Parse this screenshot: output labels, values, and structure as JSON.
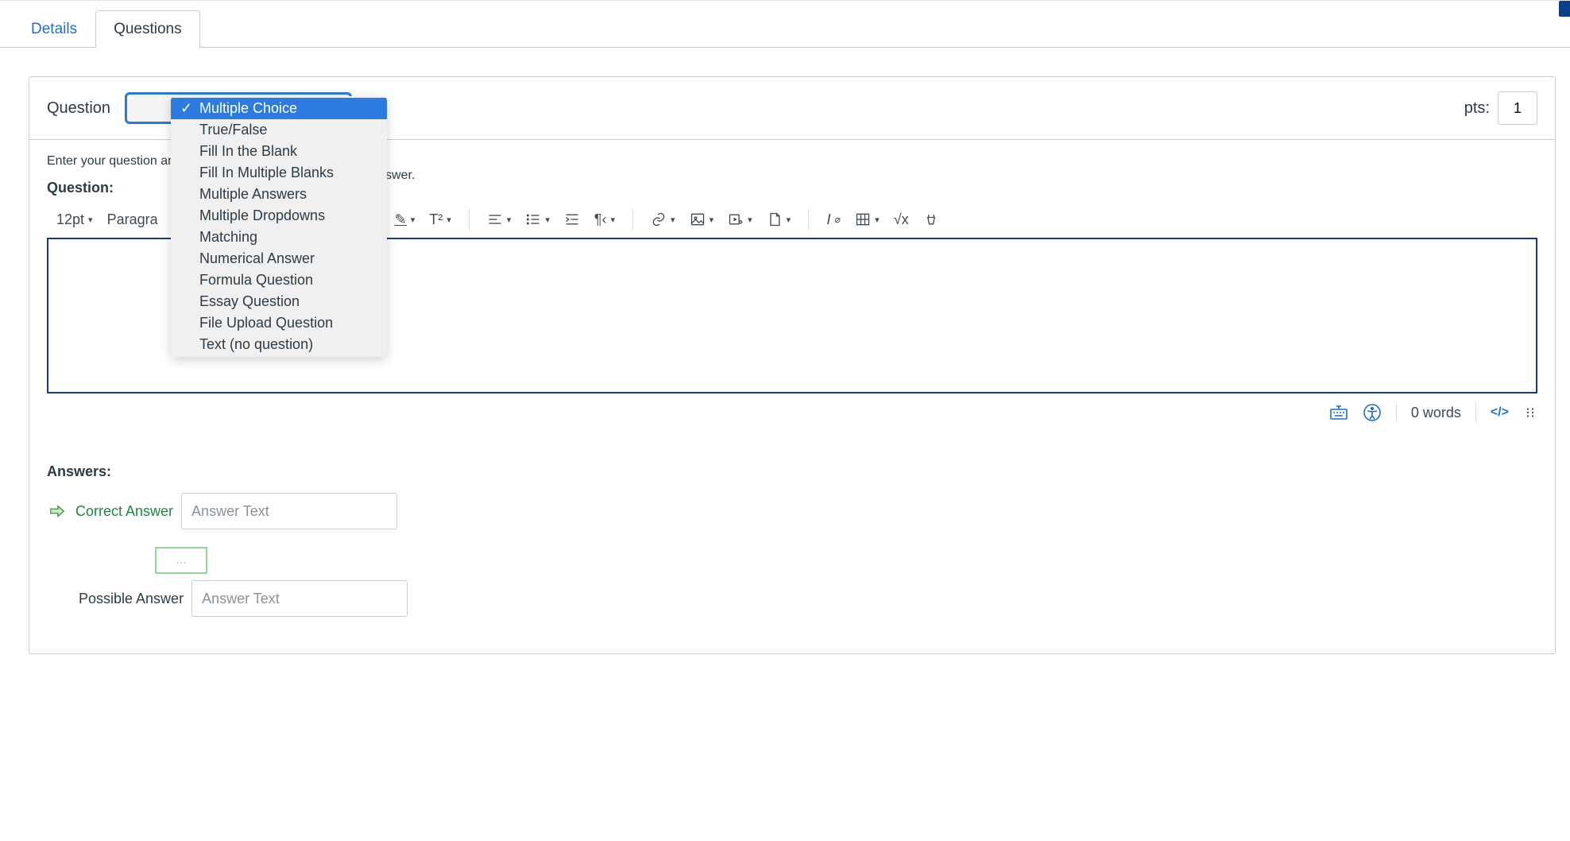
{
  "tabs": {
    "details": "Details",
    "questions": "Questions"
  },
  "header": {
    "question_label": "Question",
    "pts_label": "pts:",
    "pts_value": "1",
    "selected_type": "Multiple Choice"
  },
  "type_options": [
    {
      "label": "Multiple Choice",
      "selected": true
    },
    {
      "label": "True/False",
      "selected": false
    },
    {
      "label": "Fill In the Blank",
      "selected": false
    },
    {
      "label": "Fill In Multiple Blanks",
      "selected": false
    },
    {
      "label": "Multiple Answers",
      "selected": false
    },
    {
      "label": "Multiple Dropdowns",
      "selected": false
    },
    {
      "label": "Matching",
      "selected": false
    },
    {
      "label": "Numerical Answer",
      "selected": false
    },
    {
      "label": "Formula Question",
      "selected": false
    },
    {
      "label": "Essay Question",
      "selected": false
    },
    {
      "label": "File Upload Question",
      "selected": false
    },
    {
      "label": "Text (no question)",
      "selected": false
    }
  ],
  "body": {
    "hint_prefix": "Enter your question and m",
    "hint_suffix": "swer.",
    "question_label": "Question:"
  },
  "toolbar": {
    "font_size": "12pt",
    "paragraph": "Paragra"
  },
  "editor_footer": {
    "word_count": "0 words",
    "html_switch": "</>"
  },
  "answers": {
    "label": "Answers:",
    "correct": "Correct Answer",
    "possible": "Possible Answer",
    "placeholder": "Answer Text",
    "dots": "..."
  }
}
